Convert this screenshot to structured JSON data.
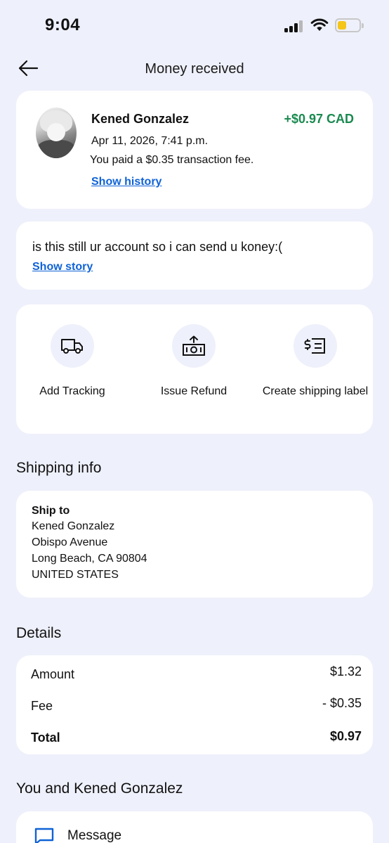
{
  "status_bar": {
    "time": "9:04"
  },
  "header": {
    "title": "Money received",
    "back_icon": "arrow-left-icon"
  },
  "transaction": {
    "sender": "Kened Gonzalez",
    "amount": "+$0.97 CAD",
    "datetime": "Apr 11, 2026, 7:41 p.m.",
    "fee_note": "You paid a $0.35 transaction fee.",
    "show_history": "Show history",
    "amount_color": "#1a8a50"
  },
  "note": {
    "text": "is this still ur account so i can send u koney:(",
    "show_story": "Show story"
  },
  "actions": [
    {
      "label": "Add Tracking",
      "icon": "truck-icon"
    },
    {
      "label": "Issue Refund",
      "icon": "refund-icon"
    },
    {
      "label": "Create shipping label",
      "icon": "shipping-label-icon"
    }
  ],
  "shipping": {
    "title": "Shipping info",
    "ship_to_label": "Ship to",
    "name": "Kened Gonzalez",
    "street": "Obispo Avenue",
    "city": "Long Beach, CA 90804",
    "country": "UNITED STATES"
  },
  "details": {
    "title": "Details",
    "rows": [
      {
        "label": "Amount",
        "value": "$1.32"
      },
      {
        "label": "Fee",
        "value": "- $0.35"
      },
      {
        "label": "Total",
        "value": "$0.97"
      }
    ]
  },
  "contact": {
    "title": "You and Kened Gonzalez",
    "message_label": "Message",
    "message_icon": "message-icon"
  },
  "colors": {
    "background": "#eef0fb",
    "link": "#0f62d6",
    "accent_green": "#1a8a50"
  }
}
